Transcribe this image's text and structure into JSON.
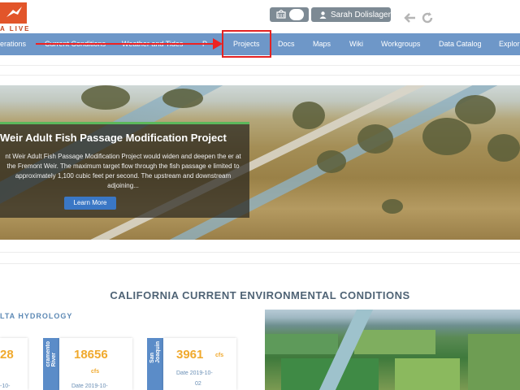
{
  "header": {
    "logo_text": "A LIVE",
    "user_name": "Sarah Dolislager"
  },
  "nav": {
    "items": [
      "erations",
      "Current Conditions",
      "Weather and Tides",
      "P",
      "Projects",
      "Docs",
      "Maps",
      "Wiki",
      "Workgroups",
      "Data Catalog",
      "Explor"
    ]
  },
  "hero": {
    "title": "Weir Adult Fish Passage Modification Project",
    "body": "nt Weir Adult Fish Passage Modification Project would widen and deepen the er at the Fremont Weir. The maximum target flow through the fish passage e limited to approximately 1,100 cubic feet per second. The upstream and downstream adjoining...",
    "button_label": "Learn More"
  },
  "section": {
    "title": "CALIFORNIA CURRENT ENVIRONMENTAL CONDITIONS",
    "hydrology_label": "LTA HYDROLOGY"
  },
  "stats": [
    {
      "side": "",
      "value": "28",
      "unit": "",
      "date": "-10-"
    },
    {
      "side": "cramento\nRiver",
      "value": "18656",
      "unit": "cfs",
      "date": "Date 2019-10-"
    },
    {
      "side": "San\nJoaquin",
      "value": "3961",
      "unit": "cfs",
      "date": "Date 2019-10-",
      "date2": "02"
    }
  ],
  "colors": {
    "nav_bg": "#6e97c8",
    "accent_orange": "#f0a92d",
    "highlight_red": "#e32222",
    "button_blue": "#3a77c5"
  }
}
